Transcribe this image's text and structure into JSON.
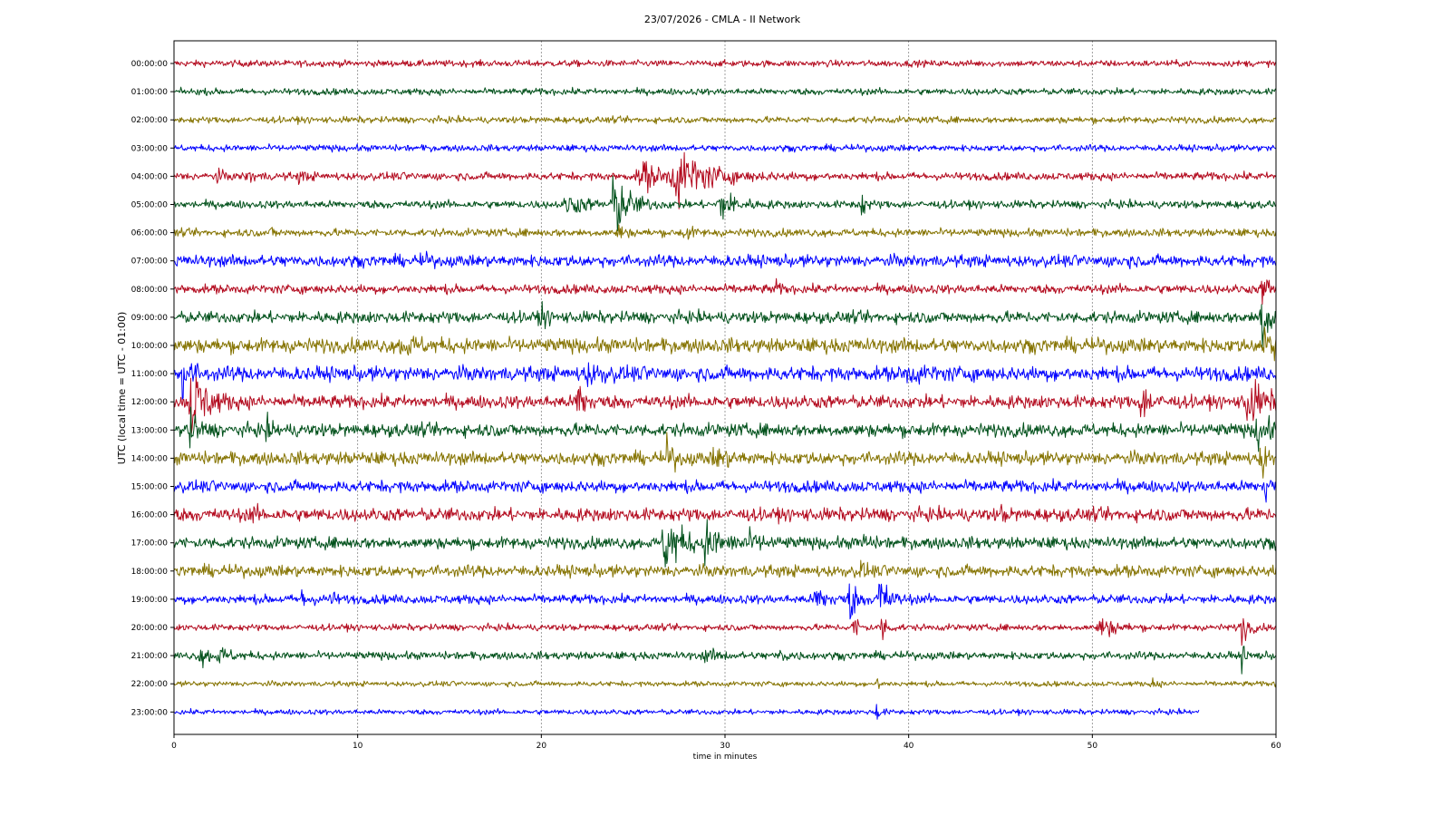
{
  "chart_data": {
    "type": "line",
    "title": "23/07/2026 - CMLA - II Network",
    "xlabel": "time in minutes",
    "ylabel": "UTC (local time = UTC - 01:00)",
    "xlim": [
      0,
      60
    ],
    "x_ticks": [
      "0",
      "10",
      "20",
      "30",
      "40",
      "50",
      "60"
    ],
    "grid": "vertical dotted lines at every 10 minutes",
    "colors": [
      "#b30a1e",
      "#00501a",
      "#857300",
      "#0000ff"
    ],
    "end_minute_last_row": 55.8,
    "rows": [
      {
        "label": "00:00:00",
        "noise": 0.25,
        "events": []
      },
      {
        "label": "01:00:00",
        "noise": 0.25,
        "events": []
      },
      {
        "label": "02:00:00",
        "noise": 0.25,
        "events": []
      },
      {
        "label": "03:00:00",
        "noise": 0.25,
        "events": []
      },
      {
        "label": "04:00:00",
        "noise": 0.3,
        "events": [
          {
            "t": 2.3,
            "amp": 0.5,
            "width": 0.4
          },
          {
            "t": 4.0,
            "amp": 0.35,
            "width": 0.7
          },
          {
            "t": 6.8,
            "amp": 0.3,
            "width": 0.7
          },
          {
            "t": 25.5,
            "amp": 1.2,
            "width": 1.5
          },
          {
            "t": 27.5,
            "amp": 2.0,
            "width": 2.5
          }
        ]
      },
      {
        "label": "05:00:00",
        "noise": 0.3,
        "events": [
          {
            "t": 21.5,
            "amp": 0.7,
            "width": 1.5
          },
          {
            "t": 24.0,
            "amp": 2.5,
            "width": 1.2
          },
          {
            "t": 29.8,
            "amp": 1.2,
            "width": 1.2
          },
          {
            "t": 37.3,
            "amp": 1.5,
            "width": 0.4
          }
        ]
      },
      {
        "label": "06:00:00",
        "noise": 0.3,
        "events": [
          {
            "t": 5.3,
            "amp": 0.3,
            "width": 0.3
          },
          {
            "t": 24.2,
            "amp": 0.8,
            "width": 0.4
          },
          {
            "t": 27.8,
            "amp": 0.7,
            "width": 0.5
          }
        ]
      },
      {
        "label": "07:00:00",
        "noise": 0.45,
        "events": [
          {
            "t": 13.5,
            "amp": 0.5,
            "width": 0.4
          },
          {
            "t": 51.5,
            "amp": 0.6,
            "width": 0.4
          }
        ]
      },
      {
        "label": "08:00:00",
        "noise": 0.35,
        "events": [
          {
            "t": 32.7,
            "amp": 0.7,
            "width": 0.3
          },
          {
            "t": 59.3,
            "amp": 1.5,
            "width": 0.5
          }
        ]
      },
      {
        "label": "09:00:00",
        "noise": 0.45,
        "events": [
          {
            "t": 20.0,
            "amp": 1.0,
            "width": 0.4
          },
          {
            "t": 59.2,
            "amp": 2.5,
            "width": 0.8
          }
        ]
      },
      {
        "label": "10:00:00",
        "noise": 0.55,
        "events": [
          {
            "t": 12.5,
            "amp": 0.7,
            "width": 1.2
          },
          {
            "t": 59.4,
            "amp": 2.5,
            "width": 0.5
          }
        ]
      },
      {
        "label": "11:00:00",
        "noise": 0.55,
        "events": [
          {
            "t": 0.5,
            "amp": 2.0,
            "width": 0.6
          },
          {
            "t": 22.5,
            "amp": 0.6,
            "width": 1.5
          },
          {
            "t": 40.0,
            "amp": 0.4,
            "width": 2.0
          }
        ]
      },
      {
        "label": "12:00:00",
        "noise": 0.5,
        "events": [
          {
            "t": 1.0,
            "amp": 2.8,
            "width": 1.2
          },
          {
            "t": 22.0,
            "amp": 1.8,
            "width": 0.6
          },
          {
            "t": 52.7,
            "amp": 1.3,
            "width": 0.8
          },
          {
            "t": 58.5,
            "amp": 1.8,
            "width": 1.3
          }
        ]
      },
      {
        "label": "13:00:00",
        "noise": 0.5,
        "events": [
          {
            "t": 0.8,
            "amp": 1.5,
            "width": 0.7
          },
          {
            "t": 5.0,
            "amp": 0.6,
            "width": 0.6
          },
          {
            "t": 59.0,
            "amp": 1.2,
            "width": 1.0
          }
        ]
      },
      {
        "label": "14:00:00",
        "noise": 0.5,
        "events": [
          {
            "t": 26.8,
            "amp": 1.3,
            "width": 0.6
          },
          {
            "t": 29.5,
            "amp": 0.6,
            "width": 1.2
          },
          {
            "t": 59.2,
            "amp": 2.0,
            "width": 0.4
          }
        ]
      },
      {
        "label": "15:00:00",
        "noise": 0.45,
        "events": [
          {
            "t": 59.4,
            "amp": 1.5,
            "width": 0.4
          }
        ]
      },
      {
        "label": "16:00:00",
        "noise": 0.5,
        "events": [
          {
            "t": 4.2,
            "amp": 0.5,
            "width": 0.5
          },
          {
            "t": 45.0,
            "amp": 0.6,
            "width": 0.3
          }
        ]
      },
      {
        "label": "17:00:00",
        "noise": 0.45,
        "events": [
          {
            "t": 26.8,
            "amp": 2.5,
            "width": 1.2
          },
          {
            "t": 29.0,
            "amp": 1.3,
            "width": 1.2
          },
          {
            "t": 31.0,
            "amp": 0.7,
            "width": 1.3
          },
          {
            "t": 37.5,
            "amp": 0.7,
            "width": 0.4
          }
        ]
      },
      {
        "label": "18:00:00",
        "noise": 0.45,
        "events": [
          {
            "t": 37.4,
            "amp": 0.6,
            "width": 0.4
          }
        ]
      },
      {
        "label": "19:00:00",
        "noise": 0.35,
        "events": [
          {
            "t": 7.0,
            "amp": 0.7,
            "width": 0.6
          },
          {
            "t": 8.5,
            "amp": 0.6,
            "width": 0.4
          },
          {
            "t": 35.0,
            "amp": 0.9,
            "width": 1.0
          },
          {
            "t": 36.8,
            "amp": 1.8,
            "width": 0.5
          },
          {
            "t": 38.4,
            "amp": 2.2,
            "width": 0.7
          }
        ]
      },
      {
        "label": "20:00:00",
        "noise": 0.25,
        "events": [
          {
            "t": 37.0,
            "amp": 1.0,
            "width": 0.5
          },
          {
            "t": 38.5,
            "amp": 1.2,
            "width": 0.5
          },
          {
            "t": 50.5,
            "amp": 0.8,
            "width": 1.2
          },
          {
            "t": 58.1,
            "amp": 1.6,
            "width": 0.5
          }
        ]
      },
      {
        "label": "21:00:00",
        "noise": 0.3,
        "events": [
          {
            "t": 1.5,
            "amp": 0.6,
            "width": 1.0
          },
          {
            "t": 2.5,
            "amp": 0.5,
            "width": 0.8
          },
          {
            "t": 29.0,
            "amp": 0.4,
            "width": 1.0
          },
          {
            "t": 33.0,
            "amp": 0.4,
            "width": 0.8
          },
          {
            "t": 58.1,
            "amp": 1.0,
            "width": 0.3
          }
        ]
      },
      {
        "label": "22:00:00",
        "noise": 0.2,
        "events": [
          {
            "t": 38.3,
            "amp": 0.5,
            "width": 0.3
          },
          {
            "t": 53.3,
            "amp": 0.5,
            "width": 0.3
          }
        ]
      },
      {
        "label": "23:00:00",
        "noise": 0.2,
        "events": [
          {
            "t": 38.2,
            "amp": 1.0,
            "width": 0.3
          }
        ]
      }
    ]
  }
}
